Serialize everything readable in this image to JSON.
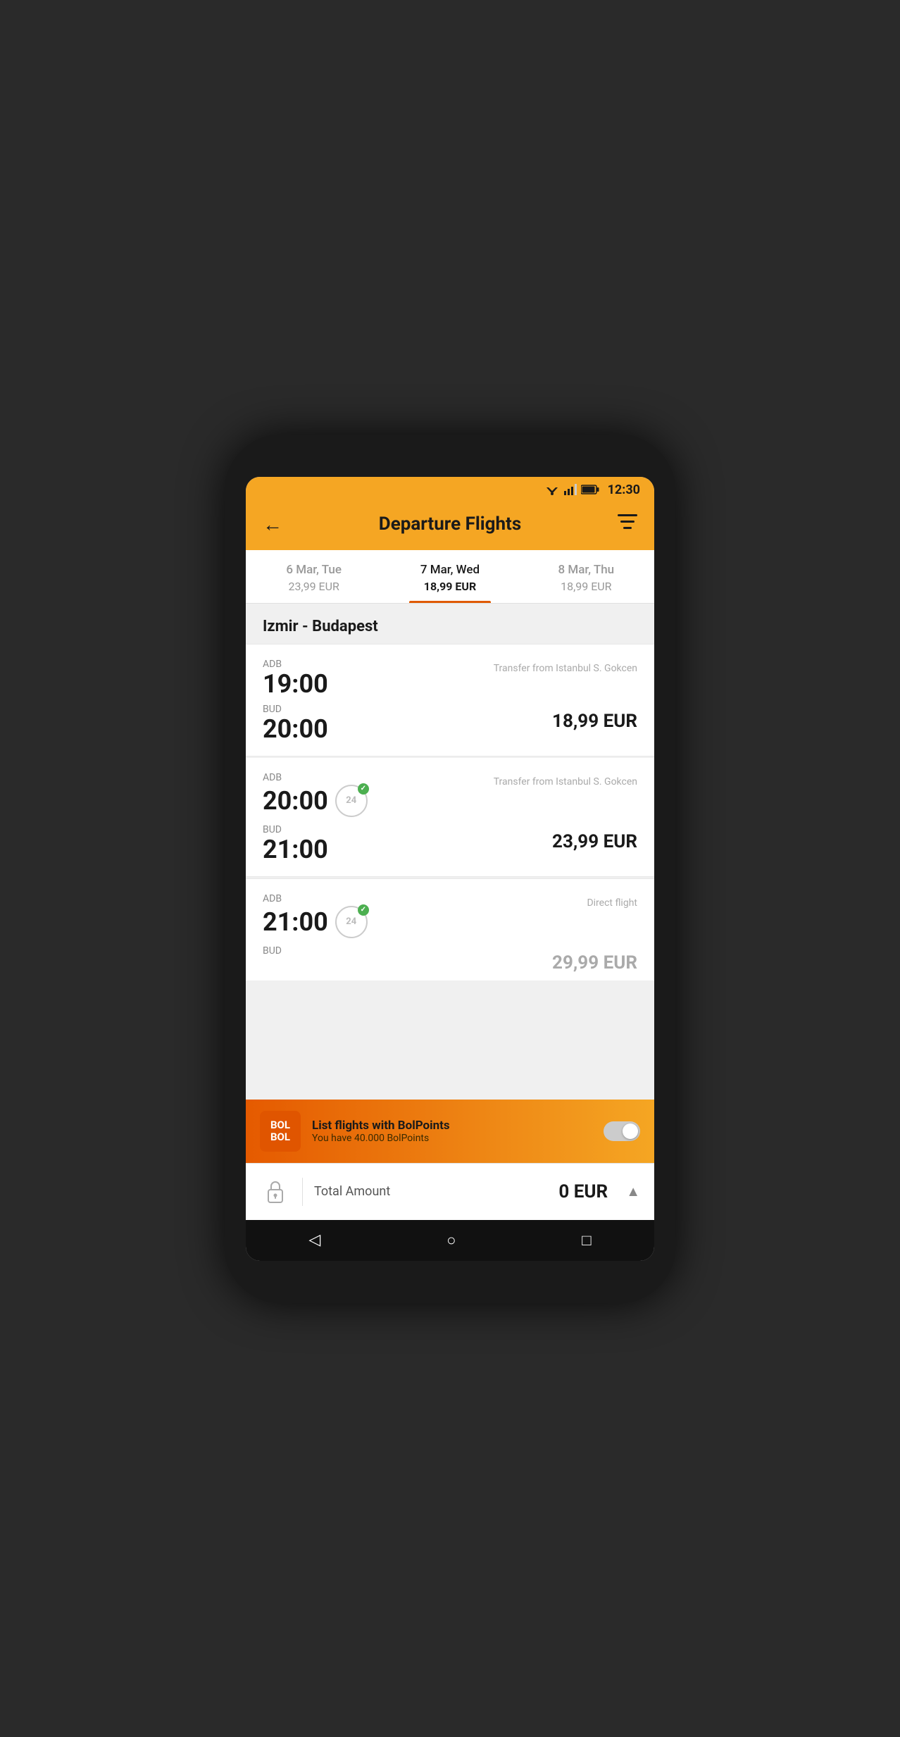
{
  "status_bar": {
    "time": "12:30"
  },
  "header": {
    "title": "Departure Flights",
    "back_label": "←",
    "filter_label": "≡"
  },
  "date_tabs": [
    {
      "id": "tab1",
      "date": "6 Mar, Tue",
      "price": "23,99 EUR",
      "active": false
    },
    {
      "id": "tab2",
      "date": "7 Mar, Wed",
      "price": "18,99 EUR",
      "active": true
    },
    {
      "id": "tab3",
      "date": "8 Mar, Thu",
      "price": "18,99 EUR",
      "active": false
    }
  ],
  "route": {
    "label": "Izmir - Budapest"
  },
  "flights": [
    {
      "id": "flight1",
      "dep_code": "ADB",
      "dep_time": "19:00",
      "arr_code": "BUD",
      "arr_time": "20:00",
      "badge_24": false,
      "transfer": "Transfer from Istanbul S. Gokcen",
      "price": "18,99 EUR",
      "direct": false
    },
    {
      "id": "flight2",
      "dep_code": "ADB",
      "dep_time": "20:00",
      "arr_code": "BUD",
      "arr_time": "21:00",
      "badge_24": true,
      "transfer": "Transfer from Istanbul S. Gokcen",
      "price": "23,99 EUR",
      "direct": false
    },
    {
      "id": "flight3",
      "dep_code": "ADB",
      "dep_time": "21:00",
      "arr_code": "BUD",
      "arr_time": "",
      "badge_24": true,
      "transfer": "Direct flight",
      "price": "29,99 EUR",
      "direct": true
    }
  ],
  "bolpoints": {
    "title": "List flights with BolPoints",
    "subtitle": "You have 40.000 BolPoints",
    "logo_line1": "BOL",
    "logo_line2": "BOL",
    "toggle_on": false
  },
  "total": {
    "label": "Total Amount",
    "amount": "0 EUR"
  },
  "bottom_nav": {
    "back": "◁",
    "home": "○",
    "recent": "□"
  }
}
